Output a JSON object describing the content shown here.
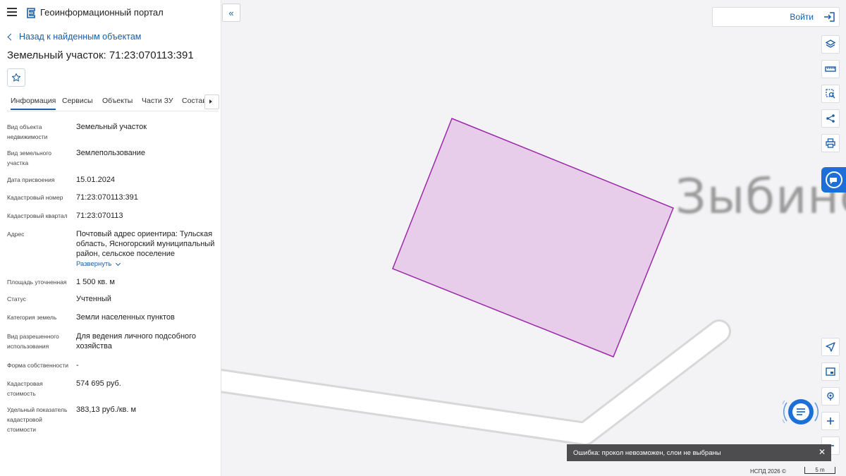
{
  "app": {
    "title": "Геоинформационный портал"
  },
  "nav": {
    "back_label": "Назад к найденным объектам"
  },
  "object": {
    "title": "Земельный участок: 71:23:070113:391"
  },
  "tabs": [
    {
      "label": "Информация",
      "active": true
    },
    {
      "label": "Сервисы",
      "active": false
    },
    {
      "label": "Объекты",
      "active": false
    },
    {
      "label": "Части ЗУ",
      "active": false
    },
    {
      "label": "Состав",
      "active": false
    }
  ],
  "properties": [
    {
      "label": "Вид объекта недвижимости",
      "value": "Земельный участок"
    },
    {
      "label": "Вид земельного участка",
      "value": "Землепользование"
    },
    {
      "label": "Дата присвоения",
      "value": "15.01.2024"
    },
    {
      "label": "Кадастровый номер",
      "value": "71:23:070113:391"
    },
    {
      "label": "Кадастровый квартал",
      "value": "71:23:070113"
    },
    {
      "label": "Адрес",
      "value": "Почтовый адрес ориентира: Тульская область, Ясногорский муниципальный район, сельское поселение"
    },
    {
      "label": "Площадь уточненная",
      "value": "1 500 кв. м"
    },
    {
      "label": "Статус",
      "value": "Учтенный"
    },
    {
      "label": "Категория земель",
      "value": "Земли населенных пунктов"
    },
    {
      "label": "Вид разрешенного использования",
      "value": "Для ведения личного подсобного хозяйства"
    },
    {
      "label": "Форма собственности",
      "value": "-"
    },
    {
      "label": "Кадастровая стоимость",
      "value": "574 695 руб."
    },
    {
      "label": "Удельный показатель кадастровой стоимости",
      "value": "383,13 руб./кв. м"
    }
  ],
  "address_expand_label": "Развернуть",
  "auth": {
    "login_label": "Войти"
  },
  "map": {
    "place_label": "Зыбинс",
    "parcel_fill": "#e8cdea",
    "parcel_stroke": "#9b2aa8"
  },
  "toast": {
    "message": "Ошибка: прокол невозможен, слои не выбраны"
  },
  "footer": {
    "attribution": "НСПД 2026 ©",
    "scale_label": "5 m"
  },
  "colors": {
    "accent": "#1a5ea8",
    "support": "#1c6fd6"
  },
  "tools": [
    "layers-icon",
    "ruler-icon",
    "select-area-icon",
    "share-icon",
    "print-icon",
    "navigate-icon",
    "minimap-icon",
    "locate-icon",
    "zoom-in-icon",
    "zoom-out-icon"
  ]
}
